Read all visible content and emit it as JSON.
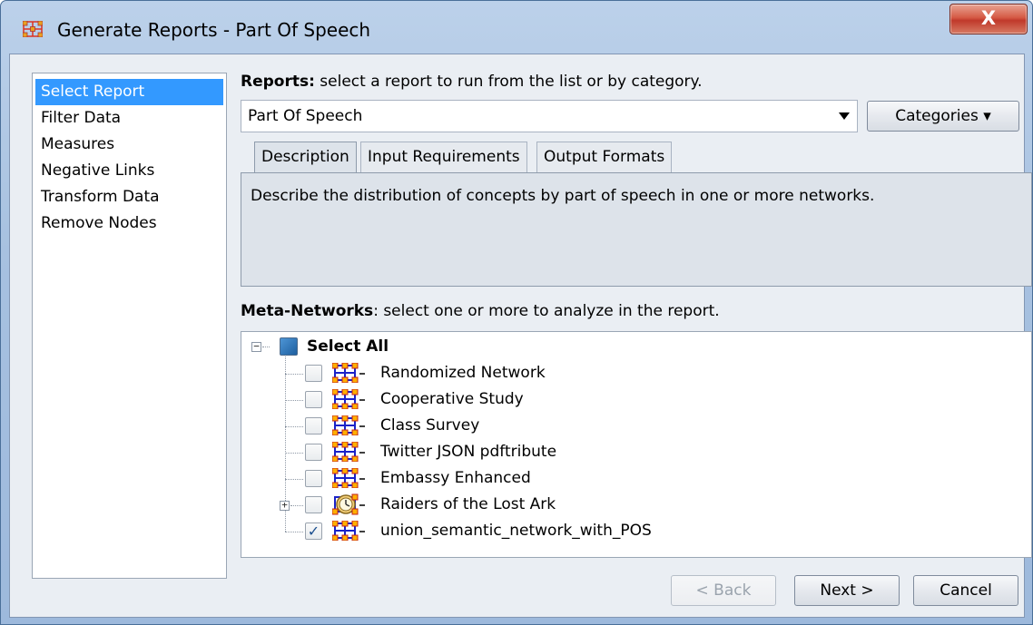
{
  "window": {
    "title": "Generate Reports - Part Of Speech",
    "close_label": "X"
  },
  "sidebar": {
    "items": [
      {
        "label": "Select Report",
        "selected": true
      },
      {
        "label": "Filter Data",
        "selected": false
      },
      {
        "label": "Measures",
        "selected": false
      },
      {
        "label": "Negative Links",
        "selected": false
      },
      {
        "label": "Transform Data",
        "selected": false
      },
      {
        "label": "Remove Nodes",
        "selected": false
      }
    ]
  },
  "reports": {
    "heading_bold": "Reports:",
    "heading_rest": " select a report to run from the list or by category.",
    "selected_report": "Part Of Speech",
    "categories_label": "Categories ▾"
  },
  "tabs": [
    {
      "label": "Description",
      "active": true
    },
    {
      "label": "Input Requirements",
      "active": false
    },
    {
      "label": "Output Formats",
      "active": false
    }
  ],
  "description_text": "Describe the distribution of concepts by part of speech in one or more networks.",
  "meta_networks": {
    "heading_bold": "Meta-Networks",
    "heading_rest": ": select one or more to analyze in the report.",
    "select_all_label": "Select All",
    "items": [
      {
        "label": "Randomized Network",
        "checked": false,
        "expandable": false,
        "icon": "network-icon"
      },
      {
        "label": "Cooperative Study",
        "checked": false,
        "expandable": false,
        "icon": "network-icon"
      },
      {
        "label": "Class Survey",
        "checked": false,
        "expandable": false,
        "icon": "network-icon"
      },
      {
        "label": "Twitter JSON pdftribute",
        "checked": false,
        "expandable": false,
        "icon": "network-icon"
      },
      {
        "label": "Embassy Enhanced",
        "checked": false,
        "expandable": false,
        "icon": "network-icon"
      },
      {
        "label": "Raiders of the Lost Ark",
        "checked": false,
        "expandable": true,
        "icon": "clock-network-icon"
      },
      {
        "label": "union_semantic_network_with_POS",
        "checked": true,
        "expandable": false,
        "icon": "network-icon"
      }
    ]
  },
  "buttons": {
    "back_label": "< Back",
    "next_label": "Next >",
    "cancel_label": "Cancel"
  },
  "colors": {
    "selection": "#3399ff",
    "title_gradient_top": "#bcd1ea",
    "close_button": "#c0392b",
    "client_background": "#eaeef3"
  }
}
